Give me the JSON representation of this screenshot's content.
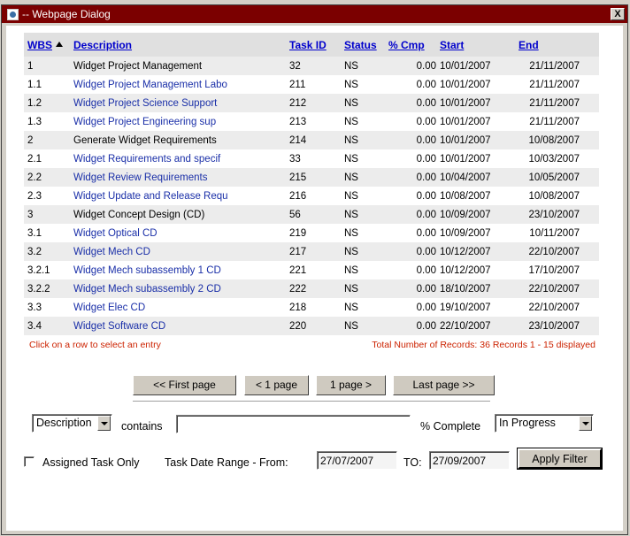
{
  "window": {
    "title": "-- Webpage Dialog",
    "close_label": "X"
  },
  "table": {
    "headers": {
      "wbs": "WBS",
      "description": "Description",
      "task_id": "Task ID",
      "status": "Status",
      "pct_cmp": "% Cmp",
      "start": "Start",
      "end": "End"
    },
    "rows": [
      {
        "wbs": "1",
        "description": "Widget Project Management",
        "task_id": "32",
        "status": "NS",
        "pct": "0.00",
        "start": "10/01/2007",
        "end": "21/11/2007"
      },
      {
        "wbs": "1.1",
        "description": "Widget Project Management Labo",
        "task_id": "211",
        "status": "NS",
        "pct": "0.00",
        "start": "10/01/2007",
        "end": "21/11/2007"
      },
      {
        "wbs": "1.2",
        "description": "Widget Project Science Support",
        "task_id": "212",
        "status": "NS",
        "pct": "0.00",
        "start": "10/01/2007",
        "end": "21/11/2007"
      },
      {
        "wbs": "1.3",
        "description": "Widget Project Engineering sup",
        "task_id": "213",
        "status": "NS",
        "pct": "0.00",
        "start": "10/01/2007",
        "end": "21/11/2007"
      },
      {
        "wbs": "2",
        "description": "Generate Widget Requirements",
        "task_id": "214",
        "status": "NS",
        "pct": "0.00",
        "start": "10/01/2007",
        "end": "10/08/2007"
      },
      {
        "wbs": "2.1",
        "description": "Widget Requirements and specif",
        "task_id": "33",
        "status": "NS",
        "pct": "0.00",
        "start": "10/01/2007",
        "end": "10/03/2007"
      },
      {
        "wbs": "2.2",
        "description": "Widget Review Requirements",
        "task_id": "215",
        "status": "NS",
        "pct": "0.00",
        "start": "10/04/2007",
        "end": "10/05/2007"
      },
      {
        "wbs": "2.3",
        "description": "Widget Update and Release Requ",
        "task_id": "216",
        "status": "NS",
        "pct": "0.00",
        "start": "10/08/2007",
        "end": "10/08/2007"
      },
      {
        "wbs": "3",
        "description": "Widget Concept Design (CD)",
        "task_id": "56",
        "status": "NS",
        "pct": "0.00",
        "start": "10/09/2007",
        "end": "23/10/2007"
      },
      {
        "wbs": "3.1",
        "description": "Widget Optical CD",
        "task_id": "219",
        "status": "NS",
        "pct": "0.00",
        "start": "10/09/2007",
        "end": "10/11/2007"
      },
      {
        "wbs": "3.2",
        "description": "Widget Mech CD",
        "task_id": "217",
        "status": "NS",
        "pct": "0.00",
        "start": "10/12/2007",
        "end": "22/10/2007"
      },
      {
        "wbs": "3.2.1",
        "description": "Widget Mech subassembly 1 CD",
        "task_id": "221",
        "status": "NS",
        "pct": "0.00",
        "start": "10/12/2007",
        "end": "17/10/2007"
      },
      {
        "wbs": "3.2.2",
        "description": "Widget Mech subassembly 2 CD",
        "task_id": "222",
        "status": "NS",
        "pct": "0.00",
        "start": "18/10/2007",
        "end": "22/10/2007"
      },
      {
        "wbs": "3.3",
        "description": "Widget Elec CD",
        "task_id": "218",
        "status": "NS",
        "pct": "0.00",
        "start": "19/10/2007",
        "end": "22/10/2007"
      },
      {
        "wbs": "3.4",
        "description": "Widget Software CD",
        "task_id": "220",
        "status": "NS",
        "pct": "0.00",
        "start": "22/10/2007",
        "end": "23/10/2007"
      }
    ]
  },
  "info": {
    "hint": "Click on a row to select an entry",
    "records": "Total Number of Records: 36 Records 1 - 15 displayed"
  },
  "pager": {
    "first": "<< First page",
    "prev": "< 1 page",
    "next": "1 page >",
    "last": "Last page >>"
  },
  "filter": {
    "field_select": "Description",
    "contains_label": "contains",
    "contains_value": "",
    "complete_label": "% Complete",
    "complete_select": "In Progress",
    "assigned_label": "Assigned Task Only",
    "range_label": "Task Date Range - From:",
    "from_value": "27/07/2007",
    "to_label": "TO:",
    "to_value": "27/09/2007",
    "apply_label": "Apply Filter"
  },
  "colors": {
    "titlebar": "#7b0000",
    "link": "#1a2fa8",
    "header_link": "#0000cc",
    "info_text": "#cc2200"
  }
}
